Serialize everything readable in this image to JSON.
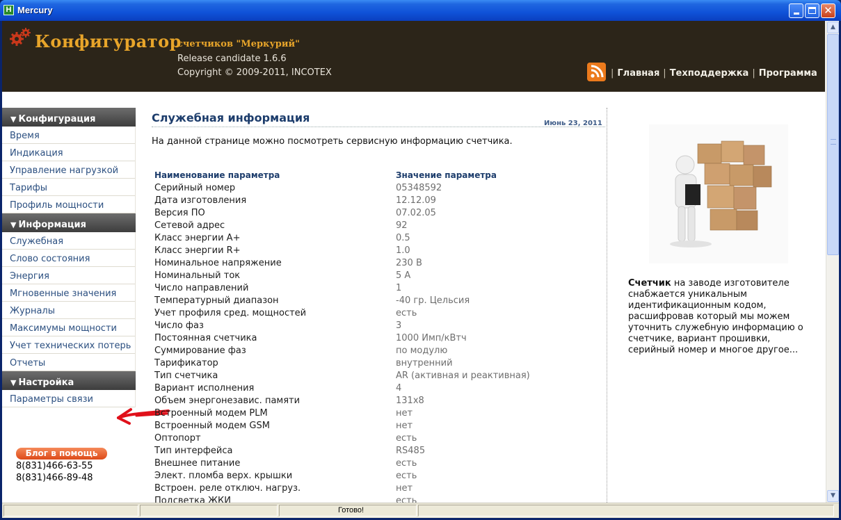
{
  "window": {
    "title": "Mercury",
    "app_icon": "app-icon"
  },
  "header": {
    "brand": "Конфигуратор",
    "subtitle": "счетчиков \"Меркурий\"",
    "release": "Release candidate 1.6.6",
    "copyright": "Copyright © 2009-2011, INCOTEX",
    "nav": [
      "Главная",
      "Техподдержка",
      "Программа"
    ],
    "colors": {
      "band": "#2c2519",
      "brand": "#e8a52a"
    }
  },
  "sidebar": {
    "sections": [
      {
        "title": "Конфигурация",
        "items": [
          "Время",
          "Индикация",
          "Управление нагрузкой",
          "Тарифы",
          "Профиль мощности"
        ]
      },
      {
        "title": "Информация",
        "items": [
          "Служебная",
          "Слово состояния",
          "Энергия",
          "Мгновенные значения",
          "Журналы",
          "Максимумы мощности",
          "Учет технических потерь",
          "Отчеты"
        ]
      },
      {
        "title": "Настройка",
        "items": [
          "Параметры связи"
        ]
      }
    ],
    "blog_button": "Блог в помощь",
    "phones": [
      "8(831)466-63-55",
      "8(831)466-89-48"
    ]
  },
  "main": {
    "title": "Служебная информация",
    "date": "Июнь 23, 2011",
    "intro": "На данной странице можно посмотреть сервисную информацию счетчика.",
    "columns": [
      "Наименование параметра",
      "Значение параметра"
    ],
    "rows": [
      [
        "Серийный номер",
        "05348592"
      ],
      [
        "Дата изготовления",
        "12.12.09"
      ],
      [
        "Версия ПО",
        "07.02.05"
      ],
      [
        "Сетевой адрес",
        "92"
      ],
      [
        "Класс энергии A+",
        "0.5"
      ],
      [
        "Класс энергии R+",
        "1.0"
      ],
      [
        "Номинальное напряжение",
        "230 В"
      ],
      [
        "Номинальный ток",
        "5 А"
      ],
      [
        "Число направлений",
        "1"
      ],
      [
        "Температурный диапазон",
        "-40 гр. Цельсия"
      ],
      [
        "Учет профиля сред. мощностей",
        "есть"
      ],
      [
        "Число фаз",
        "3"
      ],
      [
        "Постоянная счетчика",
        "1000 Имп/кВтч"
      ],
      [
        "Суммирование фаз",
        "по модулю"
      ],
      [
        "Тарификатор",
        "внутренний"
      ],
      [
        "Тип счетчика",
        "AR (активная и реактивная)"
      ],
      [
        "Вариант исполнения",
        "4"
      ],
      [
        "Объем энергонезавис. памяти",
        "131x8"
      ],
      [
        "Встроенный модем PLM",
        "нет"
      ],
      [
        "Встроенный модем GSM",
        "нет"
      ],
      [
        "Оптопорт",
        "есть"
      ],
      [
        "Тип интерфейса",
        "RS485"
      ],
      [
        "Внешнее питание",
        "есть"
      ],
      [
        "Элект. пломба верх. крышки",
        "есть"
      ],
      [
        "Встроен. реле отключ. нагруз.",
        "нет"
      ],
      [
        "Подсветка ЖКИ",
        "есть"
      ]
    ]
  },
  "aside": {
    "bold": "Счетчик",
    "text": " на заводе изготовителе снабжается уникальным идентификационным кодом, расшифровав который мы можем уточнить служебную информацию о счетчике, вариант прошивки, серийный номер и многое другое..."
  },
  "status": {
    "text": "Готово!"
  }
}
